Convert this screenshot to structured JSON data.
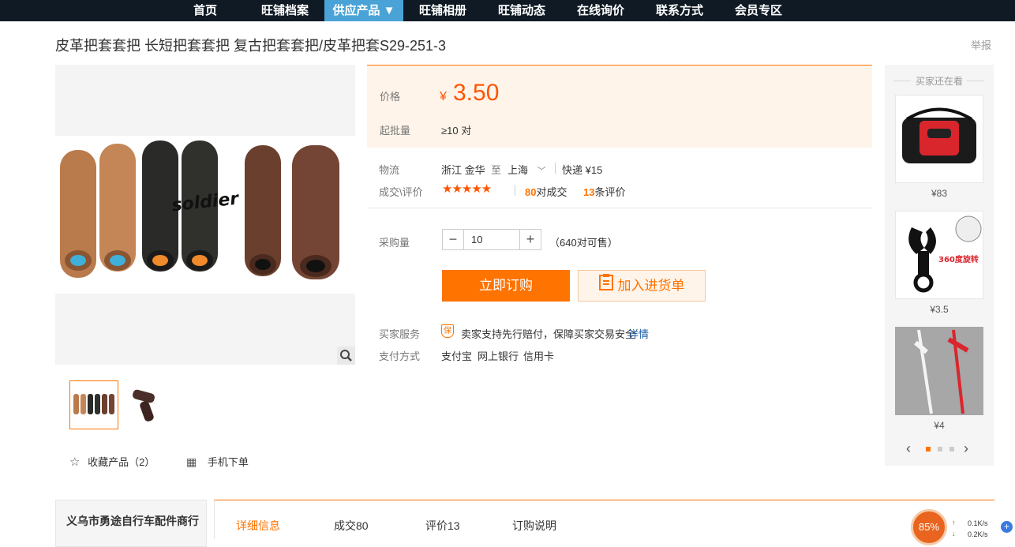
{
  "nav": {
    "items": [
      "首页",
      "旺铺档案",
      "供应产品 ▼",
      "旺铺相册",
      "旺铺动态",
      "在线询价",
      "联系方式",
      "会员专区"
    ],
    "active_index": 2
  },
  "product": {
    "title": "皮革把套套把 长短把套套把 复古把套套把/皮革把套S29-251-3",
    "report_label": "举报"
  },
  "price": {
    "label": "价格",
    "currency": "¥",
    "value": "3.50",
    "min_order_label": "起批量",
    "min_order_value": "≥10 对"
  },
  "logistics": {
    "label": "物流",
    "from": "浙江 金华",
    "to_word": "至",
    "to": "上海",
    "shipping": "快递 ¥15"
  },
  "deals": {
    "label": "成交\\评价",
    "stars": "★★★★★",
    "deals_count": "80",
    "deals_suffix": "对成交",
    "reviews_count": "13",
    "reviews_suffix": "条评价"
  },
  "purchase": {
    "qty_label": "采购量",
    "qty_value": "10",
    "minus": "−",
    "plus": "+",
    "available": "（640对可售）",
    "buy_button": "立即订购",
    "cart_button": "加入进货单"
  },
  "service": {
    "label": "买家服务",
    "text": "卖家支持先行赔付，保障买家交易安全",
    "link": "详情",
    "pay_label": "支付方式",
    "methods": [
      "支付宝",
      "网上银行",
      "信用卡"
    ]
  },
  "actions": {
    "favorite": "收藏产品（2）",
    "mobile": "手机下单"
  },
  "sidebar": {
    "title": "买家还在看",
    "items": [
      {
        "price": "¥83"
      },
      {
        "price": "¥3.5"
      },
      {
        "price": "¥4"
      }
    ],
    "badge_text": "360度旋转"
  },
  "shop": {
    "name": "义乌市勇途自行车配件商行"
  },
  "tabs": [
    "详细信息",
    "成交80",
    "评价13",
    "订购说明"
  ],
  "netwidget": {
    "percent": "85%",
    "up": "0.1K/s",
    "down": "0.2K/s"
  },
  "colors": {
    "accent": "#ff7300",
    "price": "#ff5500",
    "nav_bg": "#0f1a24",
    "nav_active": "#4aa3d6"
  }
}
